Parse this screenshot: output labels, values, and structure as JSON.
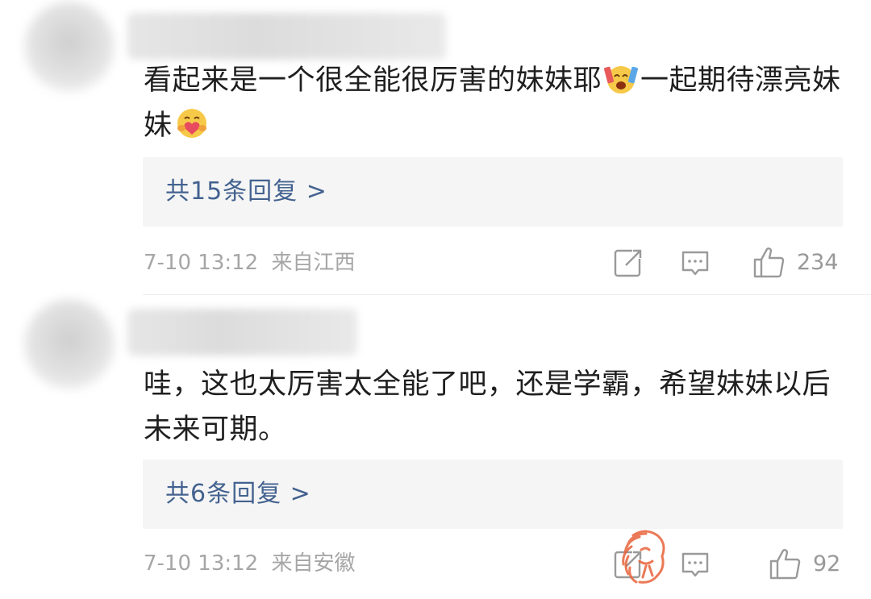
{
  "comments": [
    {
      "text_part1": "看起来是一个很全能很厉害的妹妹耶",
      "text_part2": "一起期待漂亮妹妹",
      "emoji_1": "crying-laughing-emoji",
      "emoji_2": "hug-heart-emoji",
      "replies_label": "共15条回复 >",
      "time": "7-10 13:12",
      "location": "来自江西",
      "likes": "234"
    },
    {
      "text": "哇，这也太厉害太全能了吧，还是学霸，希望妹妹以后未来可期。",
      "replies_label": "共6条回复 >",
      "time": "7-10 13:12",
      "location": "来自安徽",
      "likes": "92"
    }
  ],
  "icons": {
    "share": "share-icon",
    "comment": "comment-icon",
    "like": "thumbs-up-icon",
    "watermark": "logo-watermark"
  },
  "colors": {
    "reply_link": "#43628f",
    "meta_text": "#a6a6a6",
    "reply_box_bg": "#f5f5f5",
    "watermark": "#e8623a"
  }
}
